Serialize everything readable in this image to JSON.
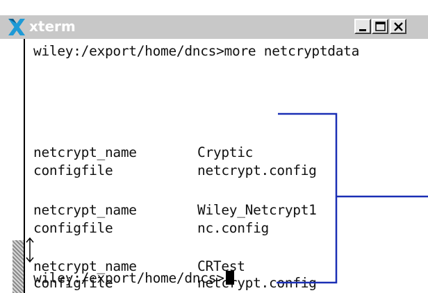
{
  "window": {
    "title": "xterm",
    "buttons": {
      "minimize_icon": "minimize-icon",
      "maximize_icon": "maximize-icon",
      "close_icon": "close-icon"
    }
  },
  "terminal": {
    "command_line": "wiley:/export/home/dncs>more netcryptdata",
    "entries": [
      {
        "name_key": "netcrypt_name",
        "name_value": "Cryptic",
        "config_key": "configfile",
        "config_value": "netcrypt.config"
      },
      {
        "name_key": "netcrypt_name",
        "name_value": "Wiley_Netcrypt1",
        "config_key": "configfile",
        "config_value": "nc.config"
      },
      {
        "name_key": "netcrypt_name",
        "name_value": "CRTest",
        "config_key": "configfile",
        "config_value": "netcrypt.config"
      }
    ],
    "prompt": "wiley:/export/home/dncs>"
  },
  "colors": {
    "titlebar": "#c8c8c8",
    "annotation_bracket": "#1a2fb5",
    "background": "#ffffff"
  }
}
